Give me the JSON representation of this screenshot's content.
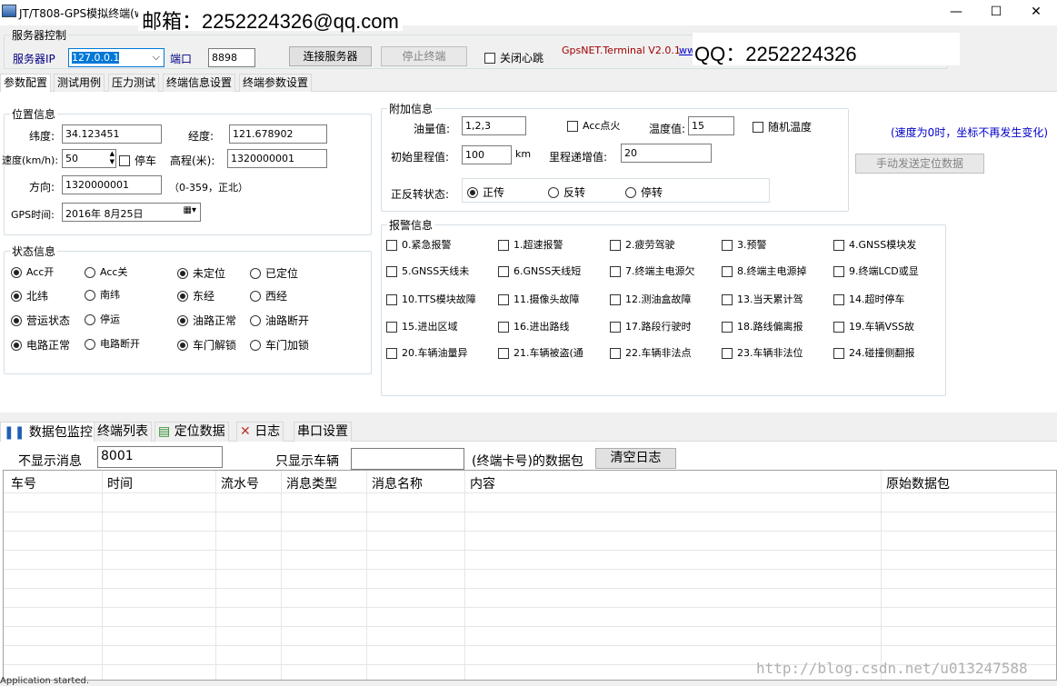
{
  "window": {
    "title": "JT/T808-GPS模拟终端(w",
    "minimize": "—",
    "maximize": "☐",
    "close": "✕"
  },
  "overlay": {
    "email": "邮箱：2252224326@qq.com",
    "qq": "QQ：2252224326"
  },
  "server": {
    "legend": "服务器控制",
    "ip_label": "服务器IP",
    "ip_value": "127.0.0.1",
    "port_label": "端口",
    "port_value": "8898",
    "connect": "连接服务器",
    "stop": "停止终端",
    "heartbeat": "关闭心跳",
    "version": "GpsNET.Terminal V2.0.1",
    "link": "ww"
  },
  "tabs": [
    "参数配置",
    "测试用例",
    "压力测试",
    "终端信息设置",
    "终端参数设置"
  ],
  "position": {
    "legend": "位置信息",
    "lat_label": "纬度:",
    "lat": "34.123451",
    "lng_label": "经度:",
    "lng": "121.678902",
    "speed_label": "速度(km/h):",
    "speed": "50",
    "stop": "停车",
    "alt_label": "高程(米):",
    "alt": "1320000001",
    "dir_label": "方向:",
    "dir": "1320000001",
    "dir_hint": "（0-359，正北）",
    "time_label": "GPS时间:",
    "time": "2016年  8月25日"
  },
  "status": {
    "legend": "状态信息",
    "options": [
      {
        "a": "Acc开",
        "a_on": true,
        "b": "Acc关",
        "b_on": false,
        "c": "未定位",
        "c_on": true,
        "d": "已定位",
        "d_on": false
      },
      {
        "a": "北纬",
        "a_on": true,
        "b": "南纬",
        "b_on": false,
        "c": "东经",
        "c_on": true,
        "d": "西经",
        "d_on": false
      },
      {
        "a": "营运状态",
        "a_on": true,
        "b": "停运",
        "b_on": false,
        "c": "油路正常",
        "c_on": true,
        "d": "油路断开",
        "d_on": false
      },
      {
        "a": "电路正常",
        "a_on": true,
        "b": "电路断开",
        "b_on": false,
        "c": "车门解锁",
        "c_on": true,
        "d": "车门加锁",
        "d_on": false
      }
    ]
  },
  "extra": {
    "legend": "附加信息",
    "oil_label": "油量值:",
    "oil": "1,2,3",
    "acc": "Acc点火",
    "temp_label": "温度值:",
    "temp": "15",
    "rand_temp": "随机温度",
    "mileage_label": "初始里程值:",
    "mileage": "100",
    "km": "km",
    "inc_label": "里程递增值:",
    "inc": "20",
    "dir_label": "正反转状态:",
    "dirs": [
      "正传",
      "反转",
      "停转"
    ]
  },
  "speed_note": "(速度为0时，坐标不再发生变化)",
  "manual_send": "手动发送定位数据",
  "alarm": {
    "legend": "报警信息",
    "items": [
      "0.紧急报警",
      "1.超速报警",
      "2.疲劳驾驶",
      "3.预警",
      "4.GNSS模块发",
      "5.GNSS天线未",
      "6.GNSS天线短",
      "7.终端主电源欠",
      "8.终端主电源掉",
      "9.终端LCD或显",
      "10.TTS模块故障",
      "11.摄像头故障",
      "12.测油盒故障",
      "13.当天累计驾",
      "14.超时停车",
      "15.进出区域",
      "16.进出路线",
      "17.路段行驶时",
      "18.路线偏离报",
      "19.车辆VSS故",
      "20.车辆油量异",
      "21.车辆被盗(通",
      "22.车辆非法点",
      "23.车辆非法位",
      "24.碰撞侧翻报"
    ]
  },
  "bottom_tabs": [
    "数据包监控",
    "终端列表",
    "定位数据",
    "日志",
    "串口设置"
  ],
  "filter": {
    "hide_label": "不显示消息",
    "hide_value": "8001",
    "only_label": "只显示车辆",
    "only_value": "",
    "suffix": "(终端卡号)的数据包",
    "clear": "清空日志"
  },
  "table": {
    "columns": [
      "车号",
      "时间",
      "流水号",
      "消息类型",
      "消息名称",
      "内容",
      "原始数据包"
    ]
  },
  "watermark": "http://blog.csdn.net/u013247588",
  "statusbar": "Application started."
}
